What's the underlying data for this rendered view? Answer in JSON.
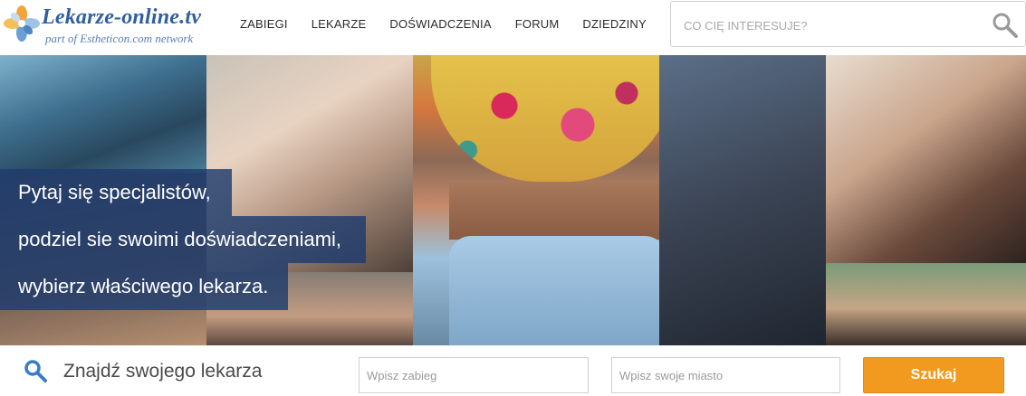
{
  "header": {
    "logo_title": "Lekarze-online.tv",
    "logo_subtitle": "part of Estheticon.com network",
    "nav": [
      {
        "label": "ZABIEGI"
      },
      {
        "label": "LEKARZE"
      },
      {
        "label": "DOŚWIADCZENIA"
      },
      {
        "label": "FORUM"
      },
      {
        "label": "DZIEDZINY"
      }
    ],
    "search_placeholder": "CO CIĘ INTERESUJE?"
  },
  "hero": {
    "lines": [
      "Pytaj się specjalistów,",
      "podziel sie swoimi doświadczeniami,",
      "wybierz właściwego lekarza."
    ]
  },
  "finder": {
    "title": "Znajdź swojego lekarza",
    "procedure_placeholder": "Wpisz zabieg",
    "city_placeholder": "Wpisz swoje miasto",
    "button_label": "Szukaj"
  },
  "colors": {
    "brand_blue": "#2f5f9e",
    "overlay": "#1e3c6e",
    "button_orange": "#f29a1f"
  },
  "icons": [
    "flower-logo-icon",
    "search-icon",
    "magnifier-icon"
  ]
}
